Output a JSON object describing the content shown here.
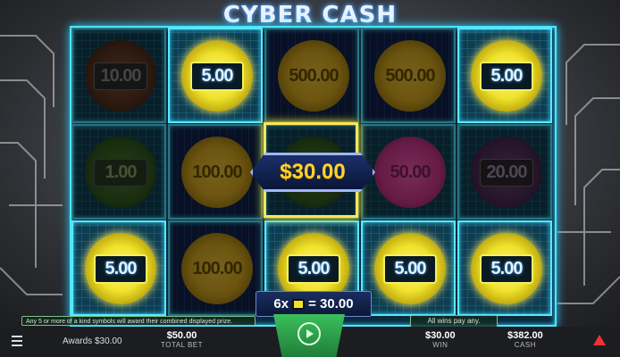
{
  "title": "CYBER CASH",
  "reels": [
    [
      {
        "value": "10.00",
        "style": "bronze",
        "dim": true
      },
      {
        "value": "1.00",
        "style": "green",
        "dim": true
      },
      {
        "value": "5.00",
        "style": "gold",
        "dim": false
      }
    ],
    [
      {
        "value": "5.00",
        "style": "gold",
        "dim": false
      },
      {
        "value": "100.00",
        "style": "big",
        "dim": true
      },
      {
        "value": "100.00",
        "style": "big",
        "dim": true
      }
    ],
    [
      {
        "value": "500.00",
        "style": "big",
        "dim": true
      },
      {
        "value": "",
        "style": "green",
        "dim": true
      },
      {
        "value": "5.00",
        "style": "gold",
        "dim": false
      }
    ],
    [
      {
        "value": "500.00",
        "style": "big",
        "dim": true
      },
      {
        "value": "50.00",
        "style": "pink",
        "dim": true
      },
      {
        "value": "5.00",
        "style": "gold",
        "dim": false
      }
    ],
    [
      {
        "value": "5.00",
        "style": "gold",
        "dim": false
      },
      {
        "value": "20.00",
        "style": "purple",
        "dim": true
      },
      {
        "value": "5.00",
        "style": "gold",
        "dim": false
      }
    ]
  ],
  "win_amount": "$30.00",
  "combo": {
    "count": "6x",
    "equals": "= 30.00"
  },
  "info_left": "Any 5 or more of a kind symbols will award their combined displayed prize.",
  "info_right": "All wins pay any.",
  "bottom_bar": {
    "awards": "Awards $30.00",
    "total_bet_value": "$50.00",
    "total_bet_label": "TOTAL BET",
    "win_value": "$30.00",
    "win_label": "WIN",
    "cash_value": "$382.00",
    "cash_label": "CASH"
  }
}
